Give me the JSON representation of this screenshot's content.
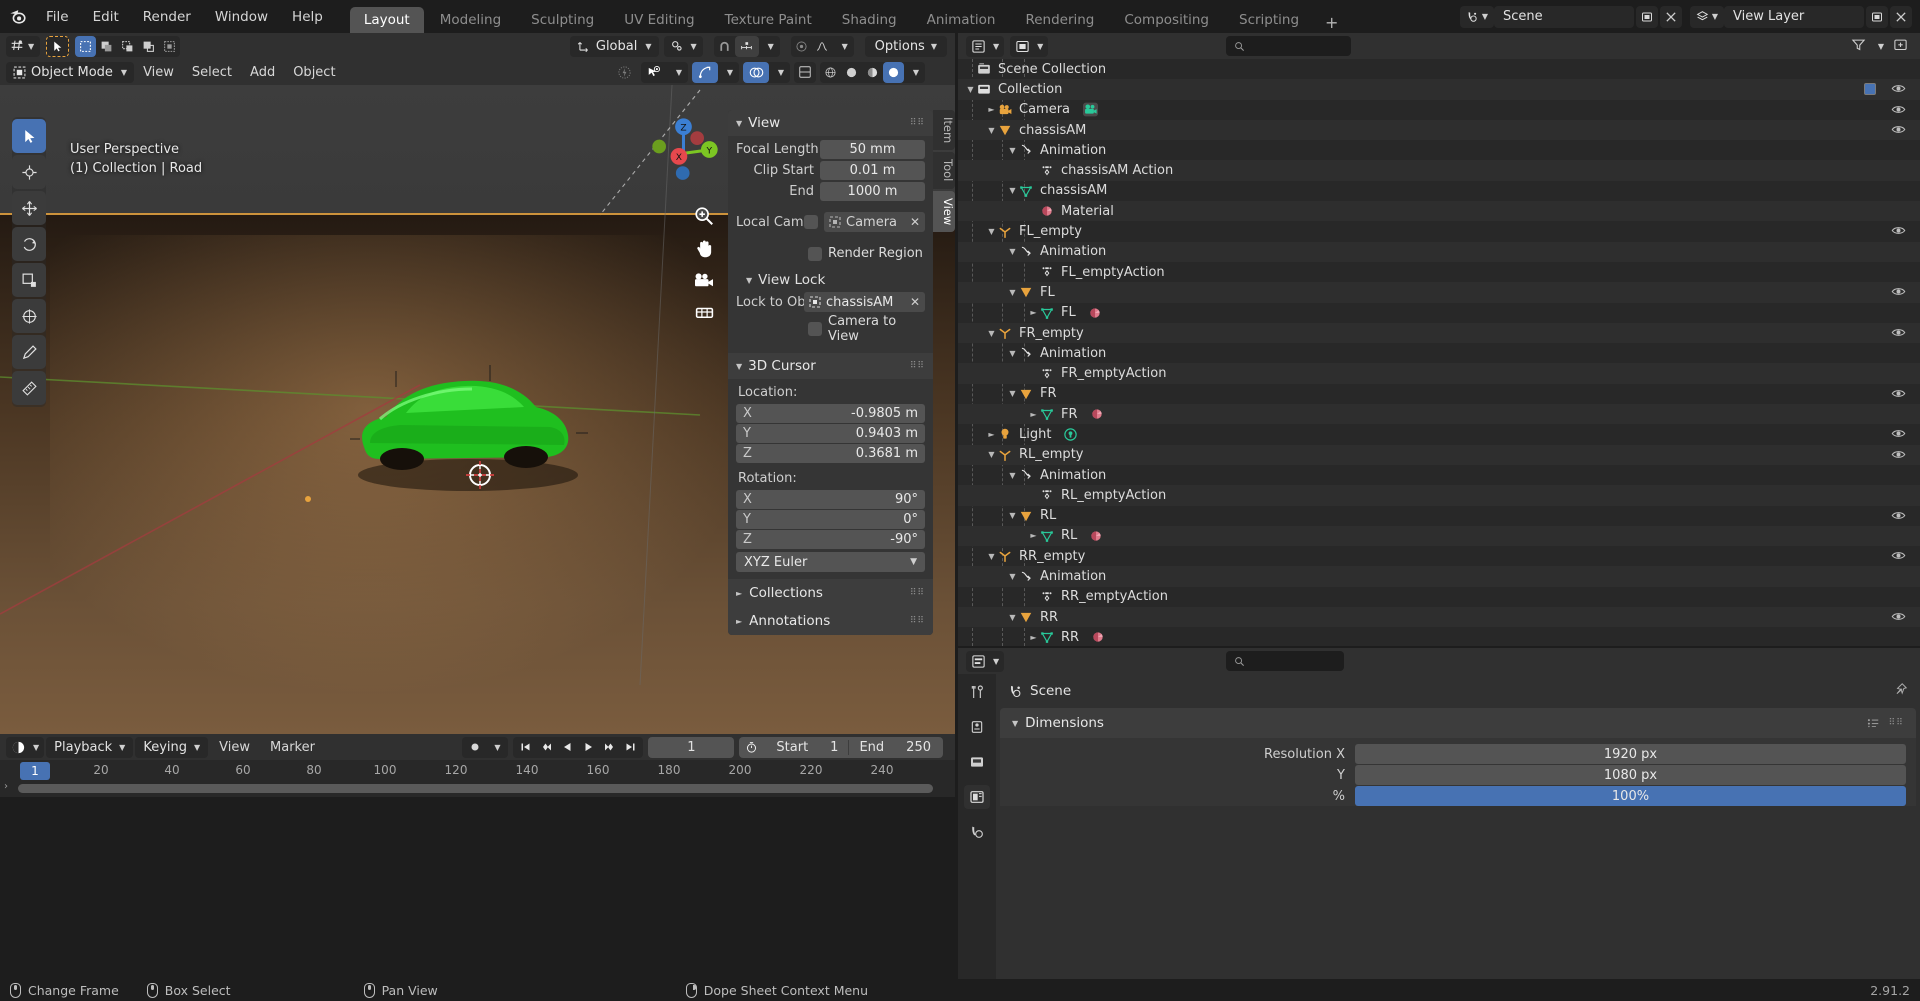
{
  "topbar": {
    "logo_icon": "blender-logo-icon",
    "menus": [
      "File",
      "Edit",
      "Render",
      "Window",
      "Help"
    ],
    "workspace_tabs": [
      "Layout",
      "Modeling",
      "Sculpting",
      "UV Editing",
      "Texture Paint",
      "Shading",
      "Animation",
      "Rendering",
      "Compositing",
      "Scripting"
    ],
    "active_workspace": "Layout",
    "add_workspace_label": "+",
    "scene_icon": "scene-icon",
    "scene_name": "Scene",
    "viewlayer_icon": "view-layer-icon",
    "viewlayer_name": "View Layer",
    "new_scene_icon": "new-scene-icon",
    "remove_scene_icon": "x-icon",
    "new_viewlayer_icon": "new-viewlayer-icon",
    "remove_viewlayer_icon": "x-icon"
  },
  "viewport": {
    "editor_type_icon": "editor-type-icon",
    "mode": "Object Mode",
    "menus": [
      "View",
      "Select",
      "Add",
      "Object"
    ],
    "transform_orientation": "Global",
    "options_label": "Options",
    "overlay_line1": "User Perspective",
    "overlay_line2": "(1) Collection | Road",
    "gizmo_axes": [
      "X",
      "Y",
      "Z"
    ],
    "tools": [
      "select-box-tool",
      "cursor-tool",
      "move-tool",
      "rotate-tool",
      "scale-tool",
      "transform-tool",
      "annotate-tool",
      "measure-tool"
    ],
    "nav_icons": [
      "zoom-icon",
      "pan-hand-icon",
      "camera-view-icon",
      "ortho-persp-icon"
    ]
  },
  "sidebar": {
    "tabs": [
      "Item",
      "Tool",
      "View"
    ],
    "active_tab": "View",
    "view_panel": {
      "title": "View",
      "focal_length_label": "Focal Length",
      "focal_length_value": "50 mm",
      "clip_start_label": "Clip Start",
      "clip_start_value": "0.01 m",
      "clip_end_label": "End",
      "clip_end_value": "1000 m",
      "local_camera_label": "Local Cam...",
      "local_camera_value": "Camera",
      "render_region_label": "Render Region",
      "view_lock_title": "View Lock",
      "lock_to_object_label": "Lock to Obj...",
      "lock_to_object_value": "chassisAM",
      "camera_to_view_label": "Camera to View"
    },
    "cursor_panel": {
      "title": "3D Cursor",
      "location_label": "Location:",
      "location": [
        {
          "axis": "X",
          "value": "-0.9805 m"
        },
        {
          "axis": "Y",
          "value": "0.9403 m"
        },
        {
          "axis": "Z",
          "value": "0.3681 m"
        }
      ],
      "rotation_label": "Rotation:",
      "rotation": [
        {
          "axis": "X",
          "value": "90°"
        },
        {
          "axis": "Y",
          "value": "0°"
        },
        {
          "axis": "Z",
          "value": "-90°"
        }
      ],
      "rotation_mode": "XYZ Euler"
    },
    "collections_panel": "Collections",
    "annotations_panel": "Annotations"
  },
  "timeline": {
    "editor_icon": "timeline-editor-icon",
    "menus": [
      "Playback",
      "Keying",
      "View",
      "Marker"
    ],
    "record_icon": "record-icon",
    "transport": [
      "jump-to-start-icon",
      "prev-keyframe-icon",
      "play-reverse-icon",
      "play-icon",
      "next-keyframe-icon",
      "jump-to-end-icon"
    ],
    "current_frame": "1",
    "timer_icon": "timer-icon",
    "start_label": "Start",
    "start_value": "1",
    "end_label": "End",
    "end_value": "250",
    "ticks": [
      "20",
      "40",
      "60",
      "80",
      "100",
      "120",
      "140",
      "160",
      "180",
      "200",
      "220",
      "240"
    ],
    "playhead_label": "1"
  },
  "statusbar": {
    "items": [
      {
        "icon": "mouse-left-icon",
        "label": "Change Frame"
      },
      {
        "icon": "mouse-left-drag-icon",
        "label": "Box Select"
      },
      {
        "icon": "mouse-middle-icon",
        "label": "Pan View"
      },
      {
        "icon": "mouse-right-icon",
        "label": "Dope Sheet Context Menu"
      }
    ],
    "version": "2.91.2"
  },
  "outliner": {
    "editor_icon": "outliner-editor-icon",
    "display_mode_icon": "display-mode-icon",
    "filter_icon": "filter-icon",
    "search_placeholder": "",
    "rows": [
      {
        "indent": 0,
        "disc": "",
        "icon": "scene-collection-icon",
        "name": "Scene Collection",
        "eye": false,
        "check": false
      },
      {
        "indent": 0,
        "disc": "▼",
        "icon": "collection-icon",
        "name": "Collection",
        "eye": true,
        "check": true
      },
      {
        "indent": 1,
        "disc": "►",
        "icon": "camera-object-icon",
        "name": "Camera",
        "eye": true,
        "check": false,
        "data_icon": "camera-data-icon"
      },
      {
        "indent": 1,
        "disc": "▼",
        "icon": "mesh-object-icon",
        "name": "chassisAM",
        "eye": true,
        "check": false
      },
      {
        "indent": 2,
        "disc": "▼",
        "icon": "animation-icon",
        "name": "Animation",
        "eye": false,
        "check": false
      },
      {
        "indent": 3,
        "disc": "",
        "icon": "action-icon",
        "name": "chassisAM Action",
        "eye": false,
        "check": false
      },
      {
        "indent": 2,
        "disc": "▼",
        "icon": "mesh-data-icon",
        "name": "chassisAM",
        "eye": false,
        "check": false
      },
      {
        "indent": 3,
        "disc": "",
        "icon": "material-icon",
        "name": "Material",
        "eye": false,
        "check": false
      },
      {
        "indent": 1,
        "disc": "▼",
        "icon": "empty-axes-icon",
        "name": "FL_empty",
        "eye": true,
        "check": false
      },
      {
        "indent": 2,
        "disc": "▼",
        "icon": "animation-icon",
        "name": "Animation",
        "eye": false,
        "check": false
      },
      {
        "indent": 3,
        "disc": "",
        "icon": "action-icon",
        "name": "FL_emptyAction",
        "eye": false,
        "check": false
      },
      {
        "indent": 2,
        "disc": "▼",
        "icon": "mesh-object-icon",
        "name": "FL",
        "eye": true,
        "check": false
      },
      {
        "indent": 3,
        "disc": "►",
        "icon": "mesh-data-icon",
        "name": "FL",
        "eye": false,
        "check": false,
        "data_icon": "material-icon"
      },
      {
        "indent": 1,
        "disc": "▼",
        "icon": "empty-axes-icon",
        "name": "FR_empty",
        "eye": true,
        "check": false
      },
      {
        "indent": 2,
        "disc": "▼",
        "icon": "animation-icon",
        "name": "Animation",
        "eye": false,
        "check": false
      },
      {
        "indent": 3,
        "disc": "",
        "icon": "action-icon",
        "name": "FR_emptyAction",
        "eye": false,
        "check": false
      },
      {
        "indent": 2,
        "disc": "▼",
        "icon": "mesh-object-icon",
        "name": "FR",
        "eye": true,
        "check": false
      },
      {
        "indent": 3,
        "disc": "►",
        "icon": "mesh-data-icon",
        "name": "FR",
        "eye": false,
        "check": false,
        "data_icon": "material-icon"
      },
      {
        "indent": 1,
        "disc": "►",
        "icon": "light-object-icon",
        "name": "Light",
        "eye": true,
        "check": false,
        "data_icon": "light-data-icon"
      },
      {
        "indent": 1,
        "disc": "▼",
        "icon": "empty-axes-icon",
        "name": "RL_empty",
        "eye": true,
        "check": false
      },
      {
        "indent": 2,
        "disc": "▼",
        "icon": "animation-icon",
        "name": "Animation",
        "eye": false,
        "check": false
      },
      {
        "indent": 3,
        "disc": "",
        "icon": "action-icon",
        "name": "RL_emptyAction",
        "eye": false,
        "check": false
      },
      {
        "indent": 2,
        "disc": "▼",
        "icon": "mesh-object-icon",
        "name": "RL",
        "eye": true,
        "check": false
      },
      {
        "indent": 3,
        "disc": "►",
        "icon": "mesh-data-icon",
        "name": "RL",
        "eye": false,
        "check": false,
        "data_icon": "material-icon"
      },
      {
        "indent": 1,
        "disc": "▼",
        "icon": "empty-axes-icon",
        "name": "RR_empty",
        "eye": true,
        "check": false
      },
      {
        "indent": 2,
        "disc": "▼",
        "icon": "animation-icon",
        "name": "Animation",
        "eye": false,
        "check": false
      },
      {
        "indent": 3,
        "disc": "",
        "icon": "action-icon",
        "name": "RR_emptyAction",
        "eye": false,
        "check": false
      },
      {
        "indent": 2,
        "disc": "▼",
        "icon": "mesh-object-icon",
        "name": "RR",
        "eye": true,
        "check": false
      },
      {
        "indent": 3,
        "disc": "►",
        "icon": "mesh-data-icon",
        "name": "RR",
        "eye": false,
        "check": false,
        "data_icon": "material-icon"
      }
    ]
  },
  "properties": {
    "editor_icon": "properties-editor-icon",
    "search_placeholder": "",
    "breadcrumb_icon": "scene-icon",
    "breadcrumb": "Scene",
    "pin_icon": "pin-icon",
    "tabs": [
      "tool-tab-icon",
      "render-tab-icon",
      "output-tab-icon",
      "viewlayer-tab-icon",
      "scene-tab-icon"
    ],
    "active_tab_index": 3,
    "dimensions_title": "Dimensions",
    "rows": [
      {
        "label": "Resolution X",
        "value": "1920 px",
        "highlight": false
      },
      {
        "label": "Y",
        "value": "1080 px",
        "highlight": false
      },
      {
        "label": "%",
        "value": "100%",
        "highlight": true
      }
    ]
  },
  "colors": {
    "accent_blue": "#4772b3",
    "panel_bg": "#303030",
    "editor_bg": "#282828",
    "field_bg": "#545454",
    "car_green": "#1fbf1f",
    "axis_x_red": "#e5484d",
    "axis_y_green": "#7cc623",
    "axis_z_blue": "#3b7fd4",
    "selection_orange": "#ed9e5c"
  }
}
